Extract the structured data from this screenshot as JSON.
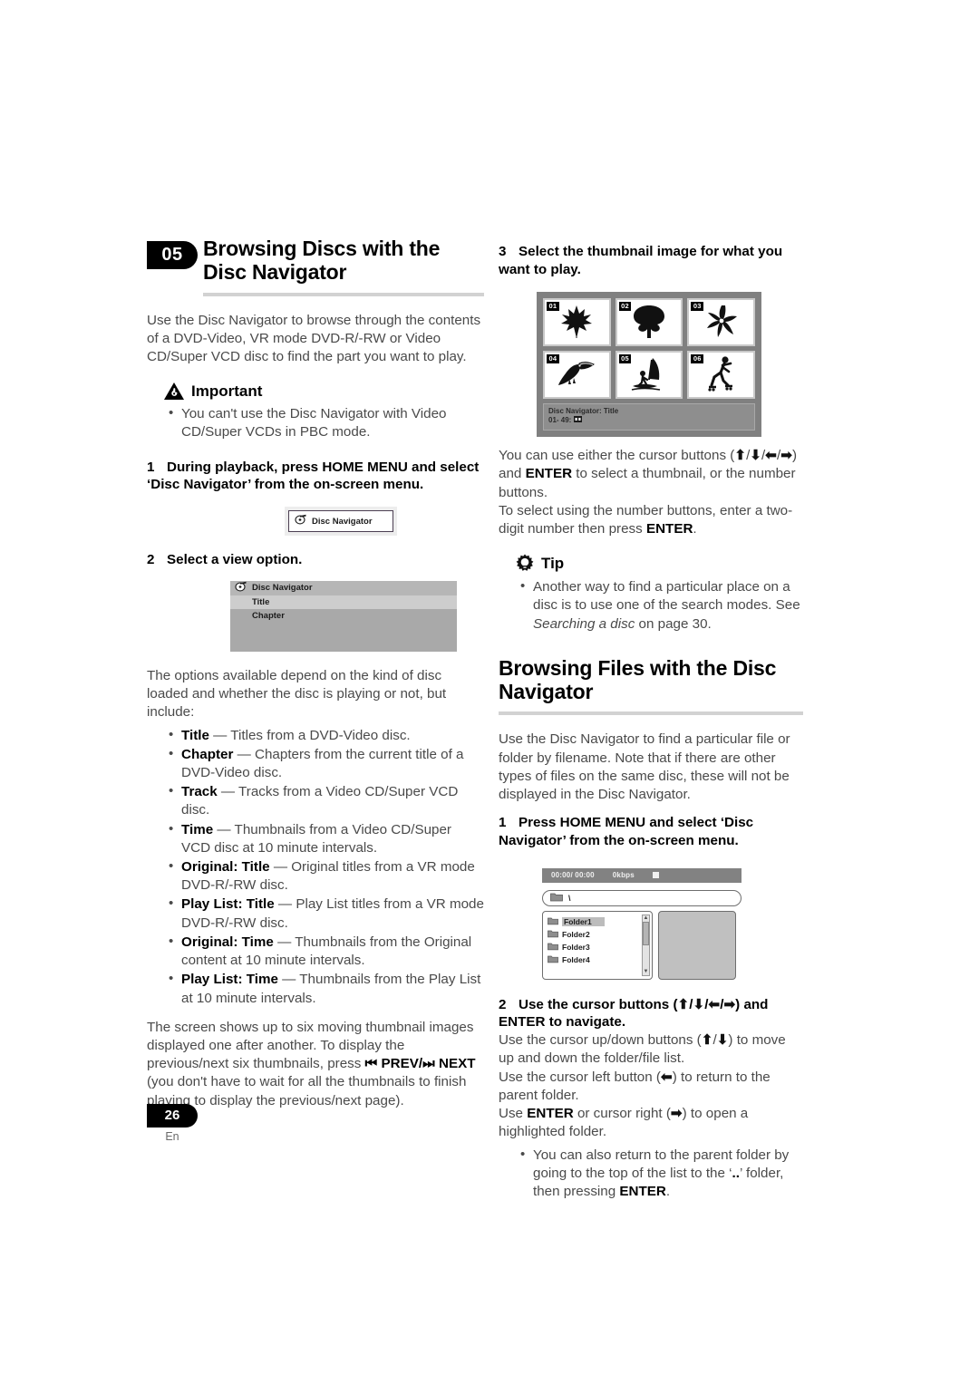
{
  "document": {
    "page_number": "26",
    "language_code": "En"
  },
  "left_column": {
    "chapter_number": "05",
    "chapter_title": "Browsing Discs with the Disc Navigator",
    "intro": "Use the Disc Navigator to browse through the contents of a DVD-Video, VR mode DVD-R/-RW or Video CD/Super VCD disc to find the part you want to play.",
    "important": {
      "icon": "warning-triangle-icon",
      "label": "Important",
      "bullets": [
        "You can't use the Disc Navigator with Video CD/Super VCDs in PBC mode."
      ]
    },
    "step1": {
      "number": "1",
      "text": "During playback, press HOME MENU and select ‘Disc Navigator’ from the on-screen menu."
    },
    "osd_button": {
      "icon": "disc-navigator-icon",
      "label": "Disc Navigator"
    },
    "step2": {
      "number": "2",
      "text": "Select a view option."
    },
    "osd_menu": {
      "icon": "disc-navigator-icon",
      "header": "Disc Navigator",
      "items": [
        {
          "label": "Title",
          "selected": true
        },
        {
          "label": "Chapter",
          "selected": false
        }
      ]
    },
    "options_intro": "The options available depend on the kind of disc loaded and whether the disc is playing or not, but include:",
    "options": [
      {
        "term": "Title",
        "desc": " — Titles from a DVD-Video disc."
      },
      {
        "term": "Chapter",
        "desc": " — Chapters from the current title of a DVD-Video disc."
      },
      {
        "term": "Track",
        "desc": " — Tracks from a Video CD/Super VCD disc."
      },
      {
        "term": "Time",
        "desc": " — Thumbnails from a Video CD/Super VCD disc at 10 minute intervals."
      },
      {
        "term": "Original: Title",
        "desc": " — Original titles from a VR mode DVD-R/-RW disc."
      },
      {
        "term": "Play List: Title",
        "desc": " — Play List titles from a VR mode DVD-R/-RW disc."
      },
      {
        "term": "Original: Time",
        "desc": " — Thumbnails from the Original content at 10 minute intervals."
      },
      {
        "term": "Play List: Time",
        "desc": " — Thumbnails from the Play List at 10 minute intervals."
      }
    ],
    "closing_1": "The screen shows up to six moving thumbnail images displayed one after another. To display the previous/next six thumbnails, press ",
    "closing_prev": "PREV",
    "closing_slash": "/",
    "closing_next": "NEXT",
    "closing_2": " (you don't have to wait for all the thumbnails to finish playing to display the previous/next page)."
  },
  "right_column": {
    "step3": {
      "number": "3",
      "text": "Select the thumbnail image for what you want to play."
    },
    "thumbnail_grid": {
      "cells": [
        {
          "number": "01",
          "art": "maple-leaf-icon"
        },
        {
          "number": "02",
          "art": "tree-icon"
        },
        {
          "number": "03",
          "art": "flower-icon"
        },
        {
          "number": "04",
          "art": "toucan-icon"
        },
        {
          "number": "05",
          "art": "windsurfer-icon"
        },
        {
          "number": "06",
          "art": "inline-skater-icon"
        }
      ],
      "status_title": "Disc Navigator: Title",
      "status_time": "01- 49:"
    },
    "cursor_para_1a": "You can use either the cursor buttons (",
    "cursor_para_1b": ") and ",
    "cursor_enter": "ENTER",
    "cursor_para_1c": " to select a thumbnail, or the number buttons.",
    "cursor_para_2a": "To select using the number buttons, enter a two-digit number then press ",
    "cursor_para_2b": ".",
    "tip": {
      "icon": "lightbulb-icon",
      "label": "Tip",
      "bullet_a": "Another way to find a particular place on a disc is to use one of the search modes. See ",
      "bullet_italic": "Searching a disc",
      "bullet_b": " on page 30."
    },
    "section_title": "Browsing Files with the Disc Navigator",
    "section_intro": "Use the Disc Navigator to find a particular file or folder by filename. Note that if there are other types of files on the same disc, these will not be displayed in the Disc Navigator.",
    "step1": {
      "number": "1",
      "text": "Press HOME MENU and select ‘Disc Navigator’ from the on-screen menu."
    },
    "file_browser": {
      "time": "00:00/ 00:00",
      "bitrate": "0kbps",
      "stop_icon": "stop-icon",
      "path_icon": "folder-icon",
      "path": "\\",
      "folders": [
        {
          "label": "Folder1",
          "selected": true
        },
        {
          "label": "Folder2",
          "selected": false
        },
        {
          "label": "Folder3",
          "selected": false
        },
        {
          "label": "Folder4",
          "selected": false
        }
      ]
    },
    "step2": {
      "number": "2",
      "text_a": "Use the cursor buttons (",
      "text_b": ") and ENTER to navigate."
    },
    "nav_para_1a": "Use the cursor up/down buttons (",
    "nav_para_1b": ") to move up and down the folder/file list.",
    "nav_para_2a": "Use the cursor left button (",
    "nav_para_2b": ") to return to the parent folder.",
    "nav_para_3a": "Use ",
    "nav_para_3b": " or cursor right (",
    "nav_para_3c": ") to open a highlighted folder.",
    "nav_bullet_a": "You can also return to the parent folder by going to the top of the list to the ‘",
    "nav_bullet_dots": "..",
    "nav_bullet_b": "’ folder, then pressing ",
    "nav_bullet_c": "."
  }
}
